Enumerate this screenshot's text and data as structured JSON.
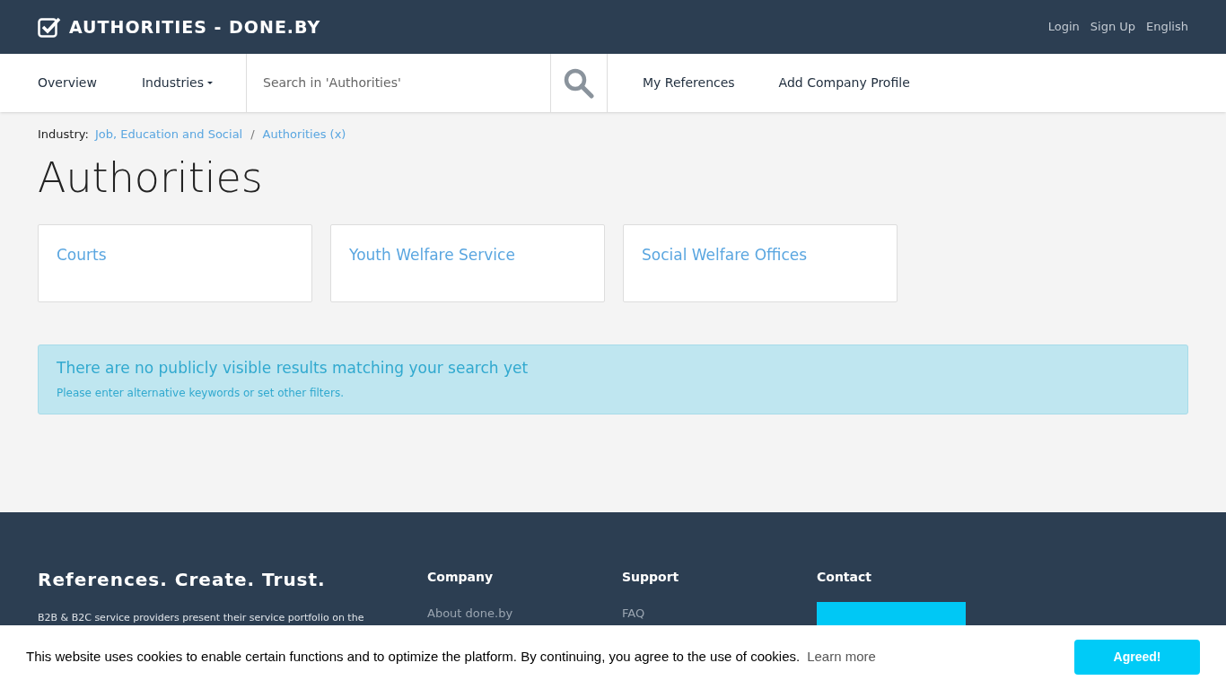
{
  "header": {
    "title": "AUTHORITIES - DONE.BY",
    "links": [
      "Login",
      "Sign Up",
      "English"
    ]
  },
  "nav": {
    "items": [
      {
        "label": "Overview",
        "dropdown": false
      },
      {
        "label": "Industries",
        "dropdown": true
      }
    ],
    "search": {
      "placeholder": "Search in 'Authorities'"
    },
    "links": [
      "My References",
      "Add Company Profile"
    ]
  },
  "breadcrumb": {
    "label": "Industry:",
    "items": [
      "Job, Education and Social",
      "Authorities (x)"
    ],
    "separator": "/"
  },
  "heading": "Authorities",
  "categories": [
    "Courts",
    "Youth Welfare Service",
    "Social Welfare Offices"
  ],
  "alert": {
    "title": "There are no publicly visible results matching your search yet",
    "text": "Please enter alternative keywords or set other filters."
  },
  "footer": {
    "tagline": "References. Create. Trust.",
    "text": "B2B & B2C service providers present their service portfolio on the",
    "columns": [
      {
        "title": "Company",
        "links": [
          "About done.by"
        ]
      },
      {
        "title": "Support",
        "links": [
          "FAQ"
        ]
      },
      {
        "title": "Contact",
        "kind": "logo"
      }
    ]
  },
  "cookie_bar": {
    "text": "This website uses cookies to enable certain functions and to optimize the platform. By continuing, you agree to the use of cookies.",
    "link": "Learn more",
    "button": "Agreed!"
  }
}
